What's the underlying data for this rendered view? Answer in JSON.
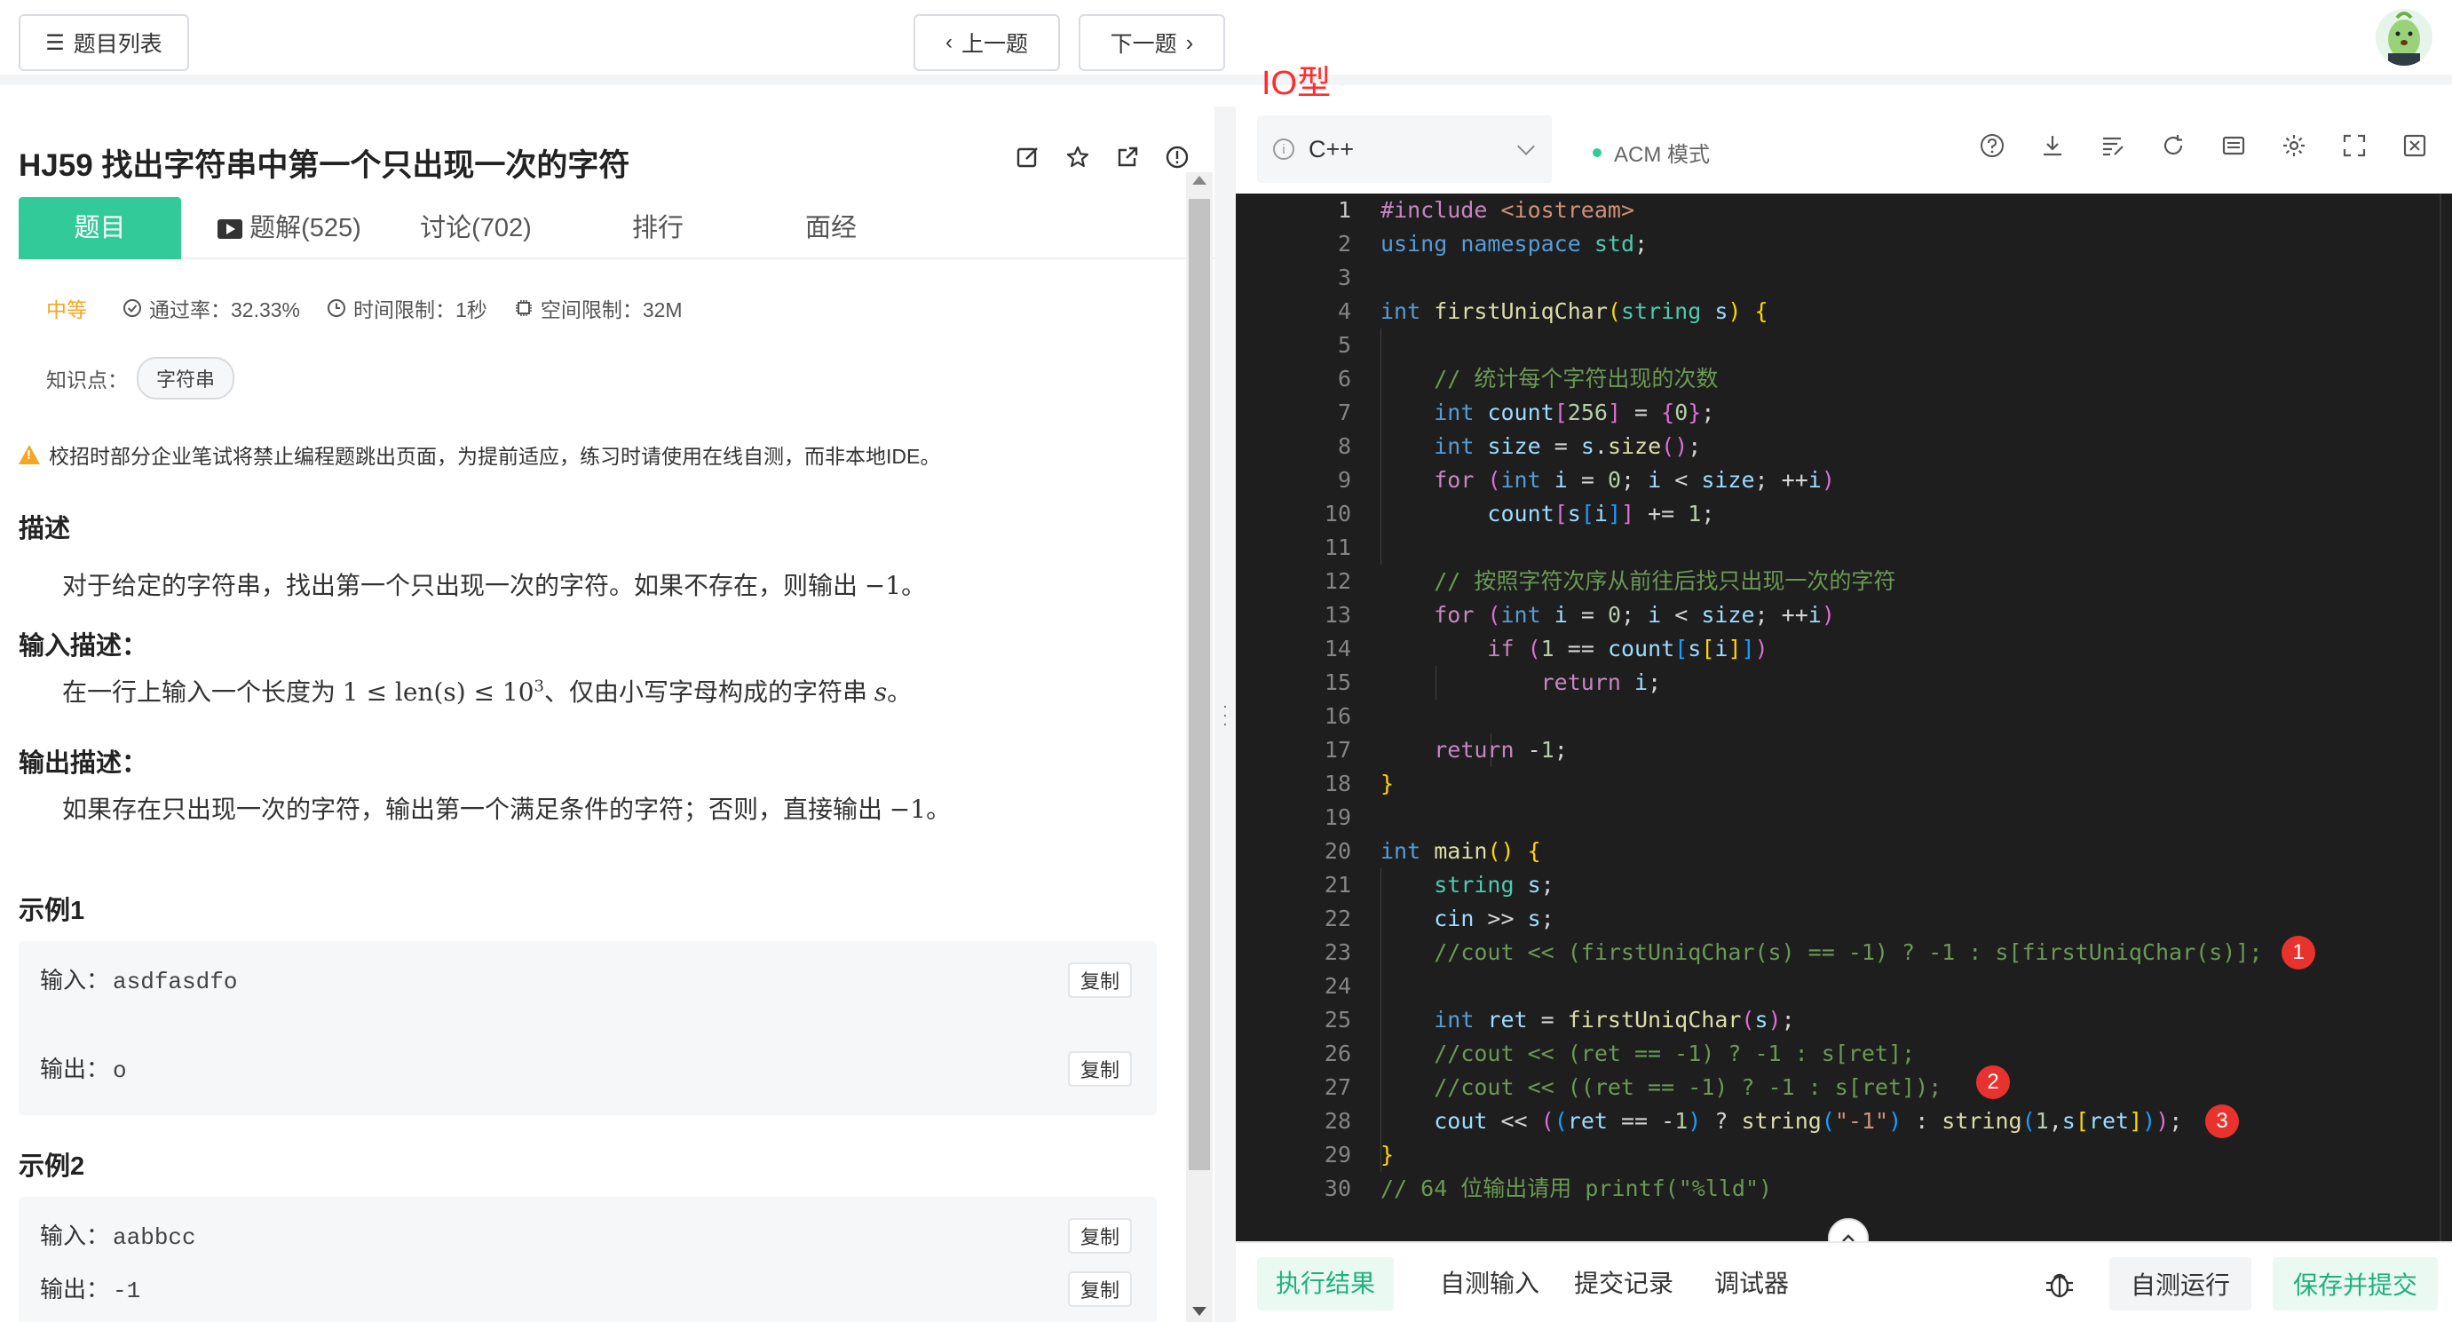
{
  "topbar": {
    "problem_list_label": "题目列表",
    "prev_label": "上一题",
    "next_label": "下一题"
  },
  "annotation": {
    "io_label": "IO型"
  },
  "problem": {
    "title": "HJ59  找出字符串中第一个只出现一次的字符",
    "tabs": [
      {
        "label": "题目"
      },
      {
        "label": "题解(525)"
      },
      {
        "label": "讨论(702)"
      },
      {
        "label": "排行"
      },
      {
        "label": "面经"
      }
    ],
    "difficulty": "中等",
    "pass_rate": "通过率：32.33%",
    "time_limit": "时间限制：1秒",
    "space_limit": "空间限制：32M",
    "knowledge_label": "知识点：",
    "knowledge_tag": "字符串",
    "warning": "校招时部分企业笔试将禁止编程题跳出页面，为提前适应，练习时请使用在线自测，而非本地IDE。",
    "description_heading": "描述",
    "description_prefix": "对于给定的字符串，找出第一个只出现一次的字符。如果不存在，则输出 ",
    "description_math": "−1",
    "description_suffix": "。",
    "input_heading": "输入描述：",
    "input_prefix": "在一行上输入一个长度为 ",
    "input_math": "1 ≤ len(s) ≤ 10",
    "input_exp": "3",
    "input_middle": "、仅由小写字母构成的字符串 ",
    "input_var": "s",
    "input_suffix": "。",
    "output_heading": "输出描述：",
    "output_prefix": "如果存在只出现一次的字符，输出第一个满足条件的字符；否则，直接输出 ",
    "output_math": "−1",
    "output_suffix": "。",
    "examples": [
      {
        "heading": "示例1",
        "input_label": "输入：",
        "input": "asdfasdfo",
        "output_label": "输出：",
        "output": "o",
        "copy": "复制"
      },
      {
        "heading": "示例2",
        "input_label": "输入：",
        "input": "aabbcc",
        "output_label": "输出：",
        "output": "-1",
        "copy": "复制"
      }
    ]
  },
  "editor": {
    "language": "C++",
    "mode": "ACM 模式",
    "line_numbers": [
      "1",
      "2",
      "3",
      "4",
      "5",
      "6",
      "7",
      "8",
      "9",
      "10",
      "11",
      "12",
      "13",
      "14",
      "15",
      "16",
      "17",
      "18",
      "19",
      "20",
      "21",
      "22",
      "23",
      "24",
      "25",
      "26",
      "27",
      "28",
      "29",
      "30"
    ],
    "badges": [
      "1",
      "2",
      "3"
    ]
  },
  "bottom": {
    "tabs": [
      "执行结果",
      "自测输入",
      "提交记录",
      "调试器"
    ],
    "run_label": "自测运行",
    "submit_label": "保存并提交"
  },
  "colors": {
    "accent": "#32ca99",
    "editor_bg": "#1e1e1e",
    "annotation_red": "#ff2d2d",
    "badge_red": "#e8322d"
  }
}
